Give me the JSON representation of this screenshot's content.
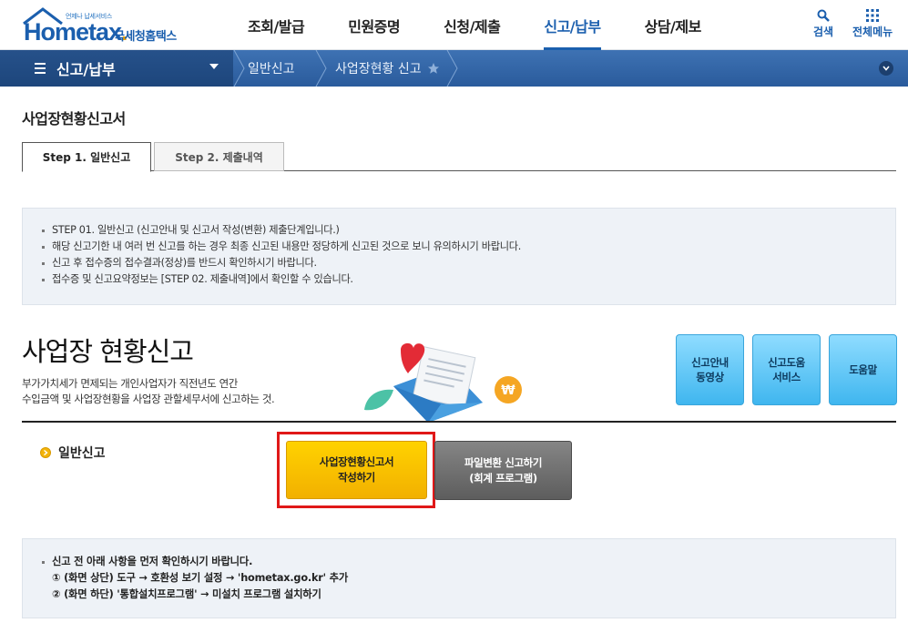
{
  "header": {
    "logo_tag": "언제나 납세서비스",
    "logo_brand_main": "Hometax",
    "logo_brand_dot": ".",
    "logo_kor": "국세청홈택스",
    "nav": [
      {
        "label": "조회/발급"
      },
      {
        "label": "민원증명"
      },
      {
        "label": "신청/제출"
      },
      {
        "label": "신고/납부",
        "active": true
      },
      {
        "label": "상담/제보"
      }
    ],
    "search_label": "검색",
    "allmenu_label": "전체메뉴",
    "accent_color": "#1b5fae"
  },
  "subnav": {
    "menu_label": "신고/납부",
    "breadcrumbs": [
      "일반신고",
      "사업장현황 신고"
    ],
    "bg_color": "#2f62a6"
  },
  "page": {
    "title": "사업장현황신고서",
    "tabs": [
      {
        "label": "Step 1. 일반신고",
        "active": true
      },
      {
        "label": "Step 2. 제출내역",
        "active": false
      }
    ],
    "info_items": [
      "STEP 01. 일반신고 (신고안내 및 신고서 작성(변환) 제출단계입니다.)",
      "해당 신고기한 내 여러 번 신고를 하는 경우 최종 신고된 내용만 정당하게 신고된 것으로 보니 유의하시기 바랍니다.",
      "신고 후 접수증의 접수결과(정상)를 반드시 확인하시기 바랍니다.",
      "접수증 및 신고요약정보는 [STEP 02. 제출내역]에서 확인할 수 있습니다."
    ]
  },
  "hero": {
    "title": "사업장 현황신고",
    "desc_line1": "부가가치세가 면제되는 개인사업자가 직전년도 연간",
    "desc_line2": "수입금액 및 사업장현황을 사업장 관할세무서에 신고하는 것.",
    "buttons": [
      {
        "line1": "신고안내",
        "line2": "동영상"
      },
      {
        "line1": "신고도움",
        "line2": "서비스"
      },
      {
        "line1": "도움말",
        "line2": ""
      }
    ]
  },
  "general": {
    "section_label": "일반신고",
    "primary_line1": "사업장현황신고서",
    "primary_line2": "작성하기",
    "secondary_line1": "파일변환 신고하기",
    "secondary_line2": "(회계 프로그램)",
    "highlight_color": "#e01818",
    "primary_color": "#ffc800"
  },
  "notice": {
    "line0": "신고 전 아래 사항을 먼저 확인하시기 바랍니다.",
    "line1": "① (화면 상단) 도구 → 호환성 보기 설정 → 'hometax.go.kr' 추가",
    "line2": "② (화면 하단) '통합설치프로그램' → 미설치 프로그램 설치하기"
  }
}
